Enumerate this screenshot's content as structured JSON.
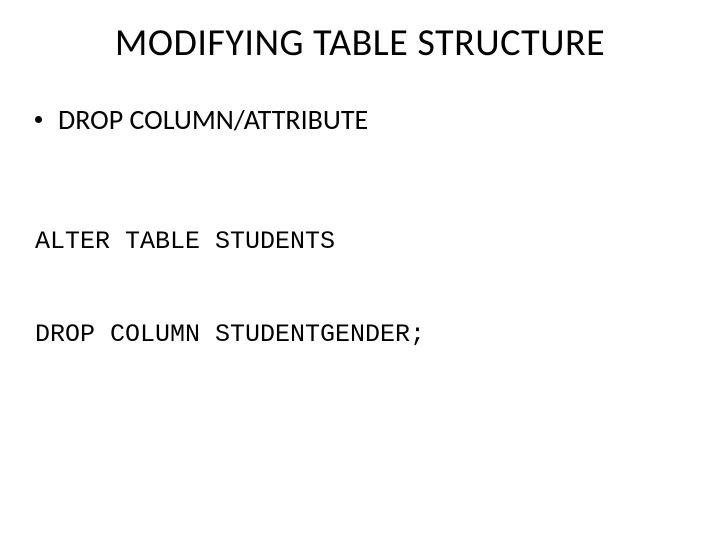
{
  "slide": {
    "title": "MODIFYING TABLE STRUCTURE",
    "bullet": "DROP COLUMN/ATTRIBUTE",
    "code_line1": "ALTER TABLE STUDENTS",
    "code_line2": "DROP COLUMN STUDENTGENDER;"
  }
}
